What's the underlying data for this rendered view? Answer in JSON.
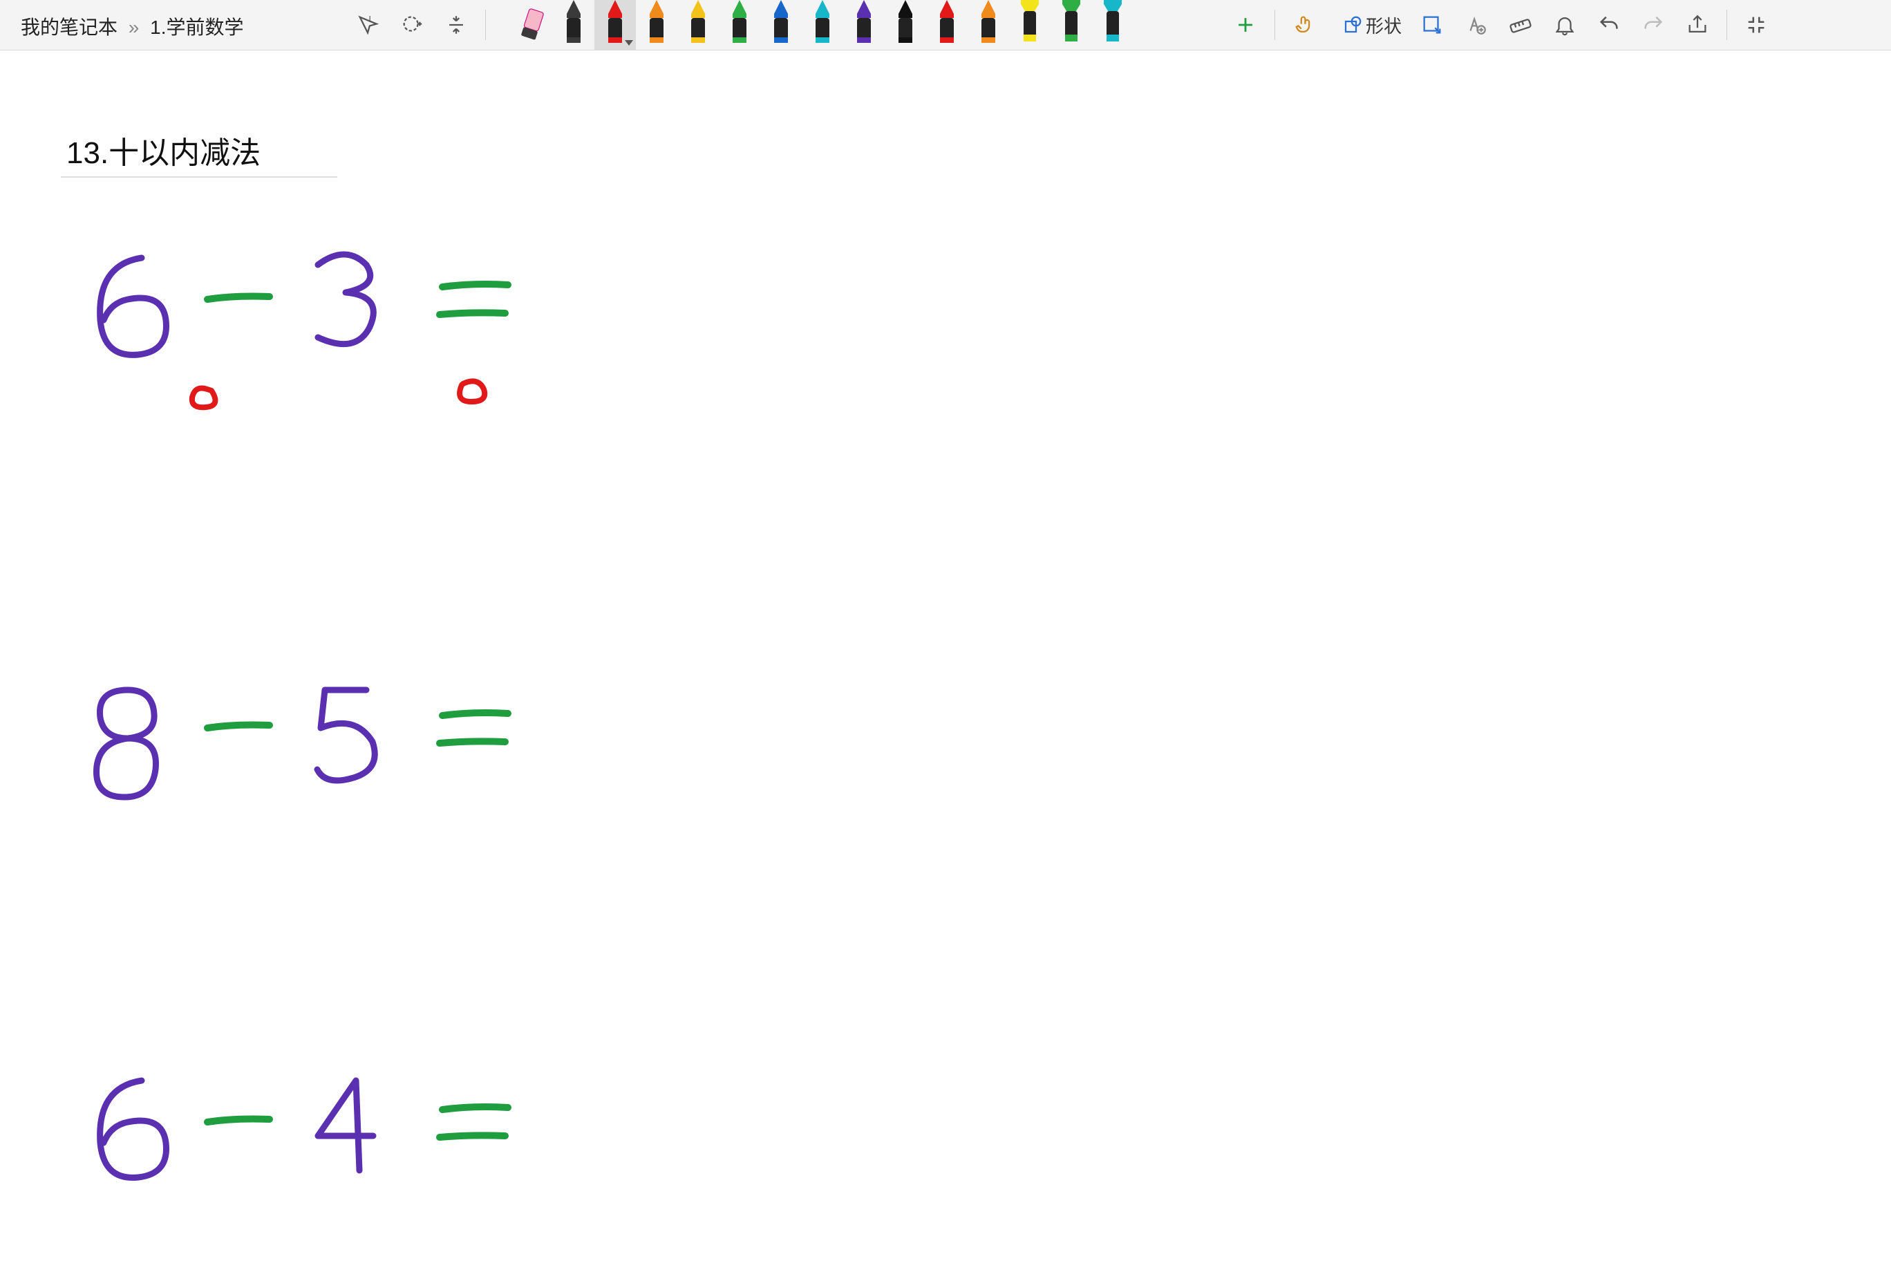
{
  "breadcrumb": {
    "notebook": "我的笔记本",
    "sep": "»",
    "page": "1.学前数学"
  },
  "heading": "13.十以内减法",
  "toolbar": {
    "shape_label": "形状"
  },
  "pens": [
    {
      "color": "#3a3a3a"
    },
    {
      "color": "#e11919",
      "selected": true
    },
    {
      "color": "#f08a1d"
    },
    {
      "color": "#f2c21b"
    },
    {
      "color": "#2fae46"
    },
    {
      "color": "#1766c9"
    },
    {
      "color": "#17b6c9"
    },
    {
      "color": "#5a2fb0"
    },
    {
      "color": "#111111"
    },
    {
      "color": "#e11919"
    },
    {
      "color": "#f08a1d"
    },
    {
      "color": "#f2e31b",
      "hl": true
    },
    {
      "color": "#2fae46",
      "hl": true
    },
    {
      "color": "#17b6c9",
      "hl": true
    }
  ],
  "ink_colors": {
    "digit": "#5a2fb0",
    "op": "#1f9d3f",
    "mark": "#e11919"
  },
  "problems": [
    {
      "a": 6,
      "b": 3
    },
    {
      "a": 8,
      "b": 5
    },
    {
      "a": 6,
      "b": 4
    }
  ]
}
